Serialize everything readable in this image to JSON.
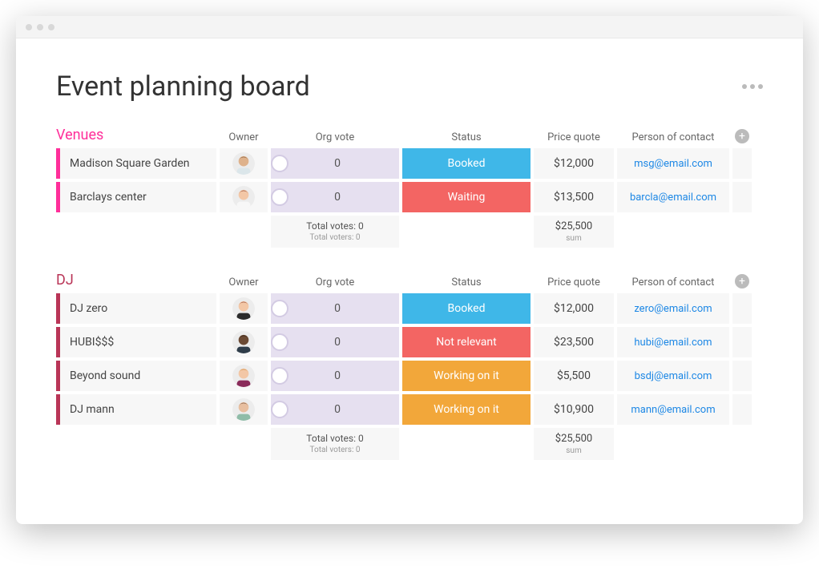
{
  "page_title": "Event planning board",
  "columns": {
    "owner": "Owner",
    "org_vote": "Org vote",
    "status": "Status",
    "price_quote": "Price quote",
    "person_of_contact": "Person of contact"
  },
  "groups": [
    {
      "id": "venues",
      "title": "Venues",
      "color_class": "venues",
      "rows": [
        {
          "name": "Madison Square Garden",
          "vote": "0",
          "status_label": "Booked",
          "status_class": "status-booked",
          "price": "$12,000",
          "contact": "msg@email.com",
          "avatar": {
            "skin": "#deb28c",
            "hair": "#7a5436",
            "shirt": "#dbe6ea"
          }
        },
        {
          "name": "Barclays center",
          "vote": "0",
          "status_label": "Waiting",
          "status_class": "status-waiting",
          "price": "$13,500",
          "contact": "barcla@email.com",
          "avatar": {
            "skin": "#f3c7a6",
            "hair": "#8a3e2a",
            "shirt": "#f7f7f7"
          }
        }
      ],
      "summary": {
        "total_votes": "Total votes: 0",
        "total_voters": "Total voters: 0",
        "price_sum": "$25,500",
        "sum_label": "sum"
      }
    },
    {
      "id": "dj",
      "title": "DJ",
      "color_class": "dj",
      "rows": [
        {
          "name": "DJ zero",
          "vote": "0",
          "status_label": "Booked",
          "status_class": "status-booked",
          "price": "$12,000",
          "contact": "zero@email.com",
          "avatar": {
            "skin": "#f3c7a6",
            "hair": "#8a3e2a",
            "shirt": "#2b2b2b"
          }
        },
        {
          "name": "HUBI$$$",
          "vote": "0",
          "status_label": "Not relevant",
          "status_class": "status-notrelevant",
          "price": "$23,500",
          "contact": "hubi@email.com",
          "avatar": {
            "skin": "#6b4a34",
            "hair": "#2c1d12",
            "shirt": "#2f3d4a"
          }
        },
        {
          "name": "Beyond sound",
          "vote": "0",
          "status_label": "Working on it",
          "status_class": "status-working",
          "price": "$5,500",
          "contact": "bsdj@email.com",
          "avatar": {
            "skin": "#f3c7a6",
            "hair": "#c98a3e",
            "shirt": "#8a2b5a"
          }
        },
        {
          "name": "DJ mann",
          "vote": "0",
          "status_label": "Working on it",
          "status_class": "status-working",
          "price": "$10,900",
          "contact": "mann@email.com",
          "avatar": {
            "skin": "#e8bfa0",
            "hair": "#6b4a34",
            "shirt": "#8fbca8"
          }
        }
      ],
      "summary": {
        "total_votes": "Total votes: 0",
        "total_voters": "Total voters: 0",
        "price_sum": "$25,500",
        "sum_label": "sum"
      }
    }
  ]
}
